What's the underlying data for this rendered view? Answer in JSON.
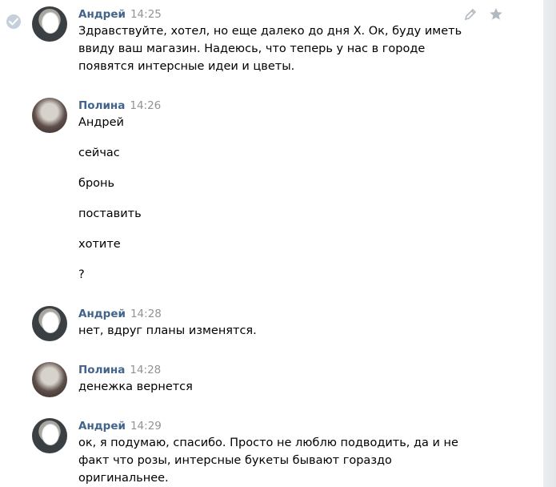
{
  "messages": [
    {
      "author": "Андрей",
      "time": "14:25",
      "lines": [
        "Здравствуйте, хотел, но еще далеко до дня Х. Ок, буду иметь",
        "ввиду ваш магазин. Надеюсь, что теперь у нас в городе",
        "появятся интерсные идеи и цветы."
      ]
    },
    {
      "author": "Полина",
      "time": "14:26",
      "lines": [
        "Андрей",
        "сейчас",
        "бронь",
        "поставить",
        "хотите",
        "?"
      ]
    },
    {
      "author": "Андрей",
      "time": "14:28",
      "lines": [
        "нет, вдруг планы изменятся."
      ]
    },
    {
      "author": "Полина",
      "time": "14:28",
      "lines": [
        "денежка вернется"
      ]
    },
    {
      "author": "Андрей",
      "time": "14:29",
      "lines": [
        "ок, я подумаю, спасибо. Просто не люблю подводить, да и не",
        "факт что розы, интерсные букеты бывают гораздо",
        "оригинальнее."
      ]
    }
  ],
  "icons": {
    "selected": "check-circle-icon",
    "edit": "pencil-icon",
    "favorite": "star-icon"
  },
  "colors": {
    "author": "#42648b",
    "time": "#939393",
    "text": "#000000"
  }
}
